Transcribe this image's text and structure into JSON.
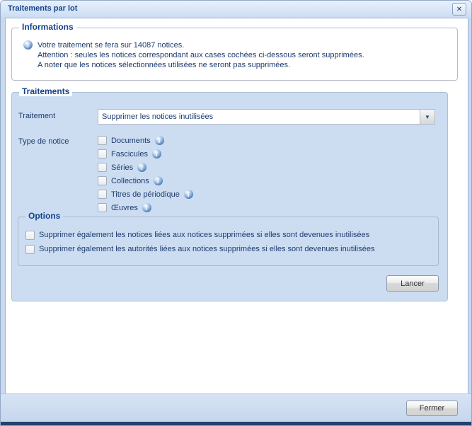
{
  "window": {
    "title": "Traitements par lot"
  },
  "informations": {
    "legend": "Informations",
    "lines": [
      "Votre traitement se fera sur 14087 notices.",
      "Attention : seules les notices correspondant aux cases cochées ci-dessous seront supprimées.",
      "A noter que les notices sélectionnées utilisées ne seront pas supprimées."
    ]
  },
  "traitements": {
    "legend": "Traitements",
    "traitement_label": "Traitement",
    "traitement_value": "Supprimer les notices inutilisées",
    "type_de_notice_label": "Type de notice",
    "notice_types": [
      {
        "label": "Documents",
        "checked": false
      },
      {
        "label": "Fascicules",
        "checked": false
      },
      {
        "label": "Séries",
        "checked": false
      },
      {
        "label": "Collections",
        "checked": false
      },
      {
        "label": "Titres de périodique",
        "checked": false
      },
      {
        "label": "Œuvres",
        "checked": false
      }
    ],
    "options": {
      "legend": "Options",
      "items": [
        {
          "label": "Supprimer également les notices liées aux notices supprimées si elles sont devenues inutilisées",
          "checked": false
        },
        {
          "label": "Supprimer également les autorités liées aux notices supprimées si elles sont devenues inutilisées",
          "checked": false
        }
      ]
    },
    "launch_button": "Lancer"
  },
  "footer": {
    "close_button": "Fermer"
  },
  "colors": {
    "accent": "#15428b",
    "frame": "#c9daf0",
    "fieldset_bg": "#ccddf2",
    "text": "#1e3c6e"
  }
}
